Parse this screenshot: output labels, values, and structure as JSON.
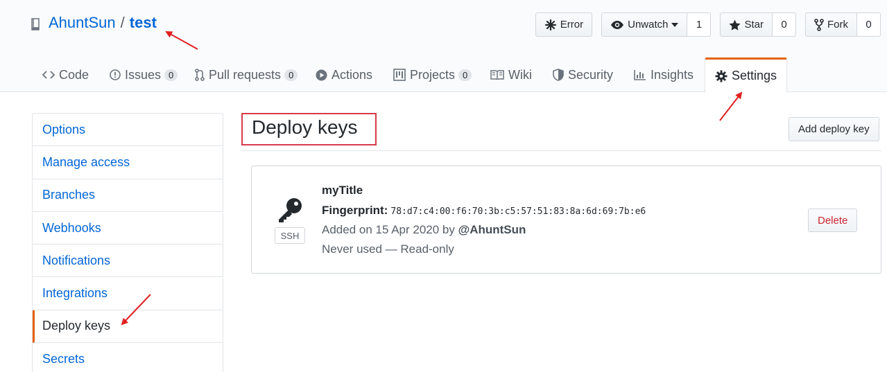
{
  "repo": {
    "owner": "AhuntSun",
    "separator": "/",
    "name": "test"
  },
  "header_actions": {
    "error_label": "Error",
    "unwatch_label": "Unwatch",
    "unwatch_count": "1",
    "star_label": "Star",
    "star_count": "0",
    "fork_label": "Fork",
    "fork_count": "0"
  },
  "tabs": [
    {
      "label": "Code"
    },
    {
      "label": "Issues",
      "count": "0"
    },
    {
      "label": "Pull requests",
      "count": "0"
    },
    {
      "label": "Actions"
    },
    {
      "label": "Projects",
      "count": "0"
    },
    {
      "label": "Wiki"
    },
    {
      "label": "Security"
    },
    {
      "label": "Insights"
    },
    {
      "label": "Settings",
      "selected": true
    }
  ],
  "sidebar": {
    "items": [
      {
        "label": "Options"
      },
      {
        "label": "Manage access"
      },
      {
        "label": "Branches"
      },
      {
        "label": "Webhooks"
      },
      {
        "label": "Notifications"
      },
      {
        "label": "Integrations"
      },
      {
        "label": "Deploy keys",
        "selected": true
      },
      {
        "label": "Secrets"
      }
    ]
  },
  "main": {
    "title": "Deploy keys",
    "add_button": "Add deploy key",
    "key": {
      "badge": "SSH",
      "title": "myTitle",
      "fingerprint_label": "Fingerprint:",
      "fingerprint": "78:d7:c4:00:f6:70:3b:c5:57:51:83:8a:6d:69:7b:e6",
      "added_prefix": "Added on 15 Apr 2020 by",
      "added_by": "@AhuntSun",
      "usage": "Never used — Read-only",
      "delete_label": "Delete"
    }
  },
  "colors": {
    "accent_orange": "#e36209",
    "link_blue": "#0366d6",
    "annotation_red": "#e02020",
    "danger_red": "#cb2431"
  }
}
